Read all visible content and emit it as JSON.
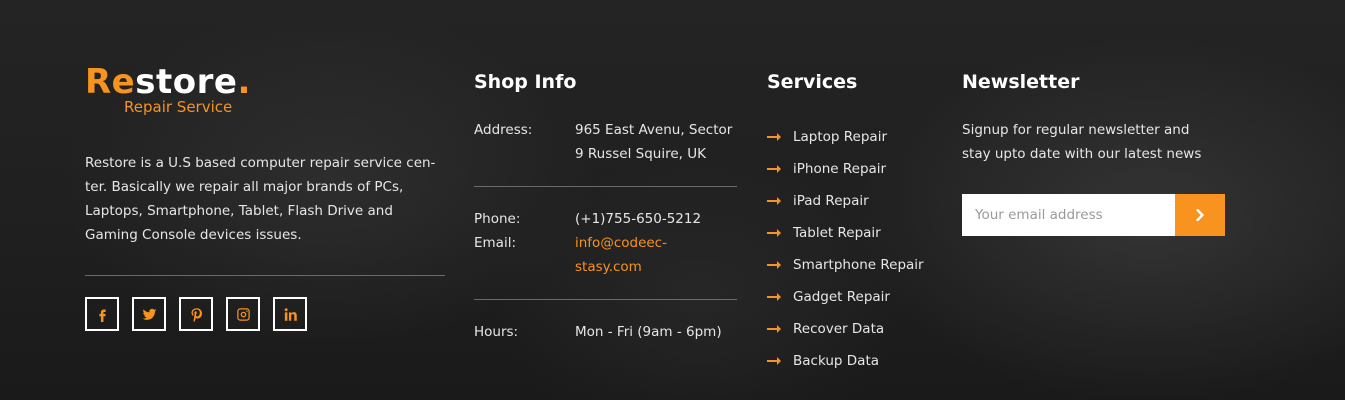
{
  "brand": {
    "logo_re": "Re",
    "logo_rest": "store",
    "logo_dot": ".",
    "tagline": "Repair Service",
    "about": "Restore is a U.S based computer repair service cen-ter. Basically we repair all major brands of PCs, Laptops, Smartphone, Tablet, Flash Drive and Gaming Console devices issues.",
    "socials": [
      {
        "name": "facebook-icon"
      },
      {
        "name": "twitter-icon"
      },
      {
        "name": "pinterest-icon"
      },
      {
        "name": "instagram-icon"
      },
      {
        "name": "linkedin-icon"
      }
    ]
  },
  "shop": {
    "heading": "Shop Info",
    "address_label": "Address:",
    "address_line1": "965 East Avenu, Sector",
    "address_line2": "9 Russel Squire, UK",
    "phone_label": "Phone:",
    "phone_value": "(+1)755-650-5212",
    "email_label": "Email:",
    "email_line1": "info@codeec-",
    "email_line2": "stasy.com",
    "hours_label": "Hours:",
    "hours_value": "Mon - Fri (9am - 6pm)"
  },
  "services": {
    "heading": "Services",
    "items": [
      {
        "label": "Laptop Repair"
      },
      {
        "label": "iPhone Repair"
      },
      {
        "label": "iPad Repair"
      },
      {
        "label": "Tablet Repair"
      },
      {
        "label": "Smartphone Repair"
      },
      {
        "label": "Gadget Repair"
      },
      {
        "label": "Recover Data"
      },
      {
        "label": "Backup Data"
      }
    ]
  },
  "newsletter": {
    "heading": "Newsletter",
    "text": "Signup for regular newsletter and stay upto date with our latest news",
    "input_placeholder": "Your email address",
    "input_value": ""
  },
  "colors": {
    "accent": "#f7931e",
    "background": "#1e1e1e",
    "text": "#e6e6e6"
  }
}
